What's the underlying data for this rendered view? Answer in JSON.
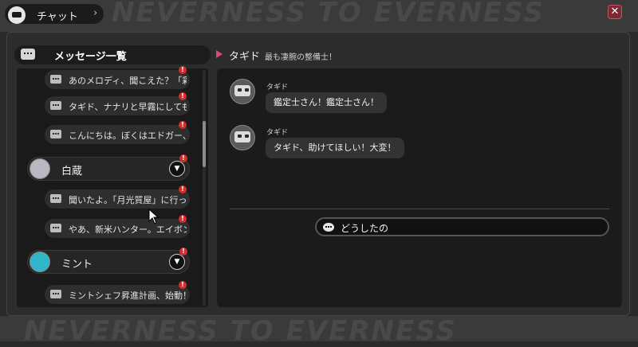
{
  "header": {
    "title": "チャット",
    "close_label": "✕"
  },
  "background": {
    "watermark": "NEVERNESS TO EVERNESS"
  },
  "list": {
    "title": "メッセージ一覧",
    "items": [
      {
        "text": "あのメロディ、聞こえた？「彩",
        "badge": "!"
      },
      {
        "text": "タギド、ナナリと早霧にしてもら",
        "badge": "!"
      },
      {
        "text": "こんにちは。ぼくはエドガー、",
        "badge": "!"
      },
      {
        "text": "聞いたよ。「月光質屋」に行っ",
        "badge": "!"
      },
      {
        "text": "やあ、新米ハンター。エイボン",
        "badge": "!"
      },
      {
        "text": "ミントシェフ昇進計画、始動！",
        "badge": "!"
      }
    ],
    "contacts": [
      {
        "name": "白蔵",
        "expand": "▼",
        "badge": "!"
      },
      {
        "name": "ミント",
        "expand": "▼",
        "badge": "!"
      }
    ]
  },
  "conversation": {
    "name": "タギド",
    "subtitle": "最も凄腕の整備士！",
    "messages": [
      {
        "speaker": "タギド",
        "text": "鑑定士さん！鑑定士さん！"
      },
      {
        "speaker": "タギド",
        "text": "タギド、助けてほしい！大変！"
      }
    ],
    "reply_option": "どうしたの"
  },
  "colors": {
    "accent_pink": "#e0457b",
    "badge_red": "#d12f2f",
    "close_red": "#7b2a35"
  }
}
